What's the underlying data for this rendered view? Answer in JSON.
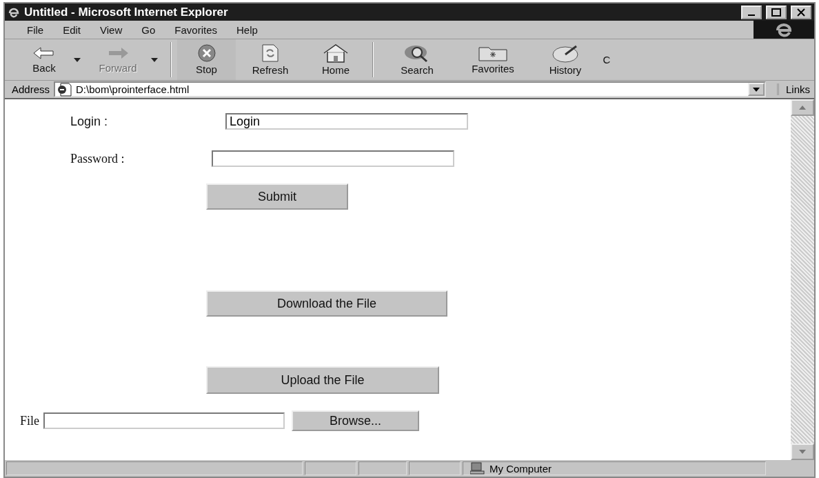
{
  "window": {
    "title": "Untitled - Microsoft Internet Explorer"
  },
  "menu": [
    "File",
    "Edit",
    "View",
    "Go",
    "Favorites",
    "Help"
  ],
  "toolbar": [
    {
      "kind": "back",
      "label": "Back",
      "disabled": false,
      "dropdown": true
    },
    {
      "kind": "forward",
      "label": "Forward",
      "disabled": true,
      "dropdown": true
    },
    {
      "kind": "stop",
      "label": "Stop",
      "disabled": false,
      "dropdown": false
    },
    {
      "kind": "refresh",
      "label": "Refresh",
      "disabled": false,
      "dropdown": false
    },
    {
      "kind": "home",
      "label": "Home",
      "disabled": false,
      "dropdown": false
    },
    {
      "kind": "search",
      "label": "Search",
      "disabled": false,
      "dropdown": false
    },
    {
      "kind": "favorites",
      "label": "Favorites",
      "disabled": false,
      "dropdown": false
    },
    {
      "kind": "history",
      "label": "History",
      "disabled": false,
      "dropdown": false
    },
    {
      "kind": "cut",
      "label": "C",
      "disabled": false,
      "dropdown": false
    }
  ],
  "address_bar": {
    "label": "Address",
    "value": "D:\\bom\\prointerface.html",
    "links": "Links"
  },
  "form": {
    "login": {
      "label": "Login :",
      "value": "Login"
    },
    "password": {
      "label": "Password :"
    },
    "submit": "Submit",
    "download": "Download the File",
    "upload": "Upload the File",
    "file": {
      "label": "File",
      "browse": "Browse..."
    }
  },
  "status_bar": {
    "zone": "My Computer"
  }
}
